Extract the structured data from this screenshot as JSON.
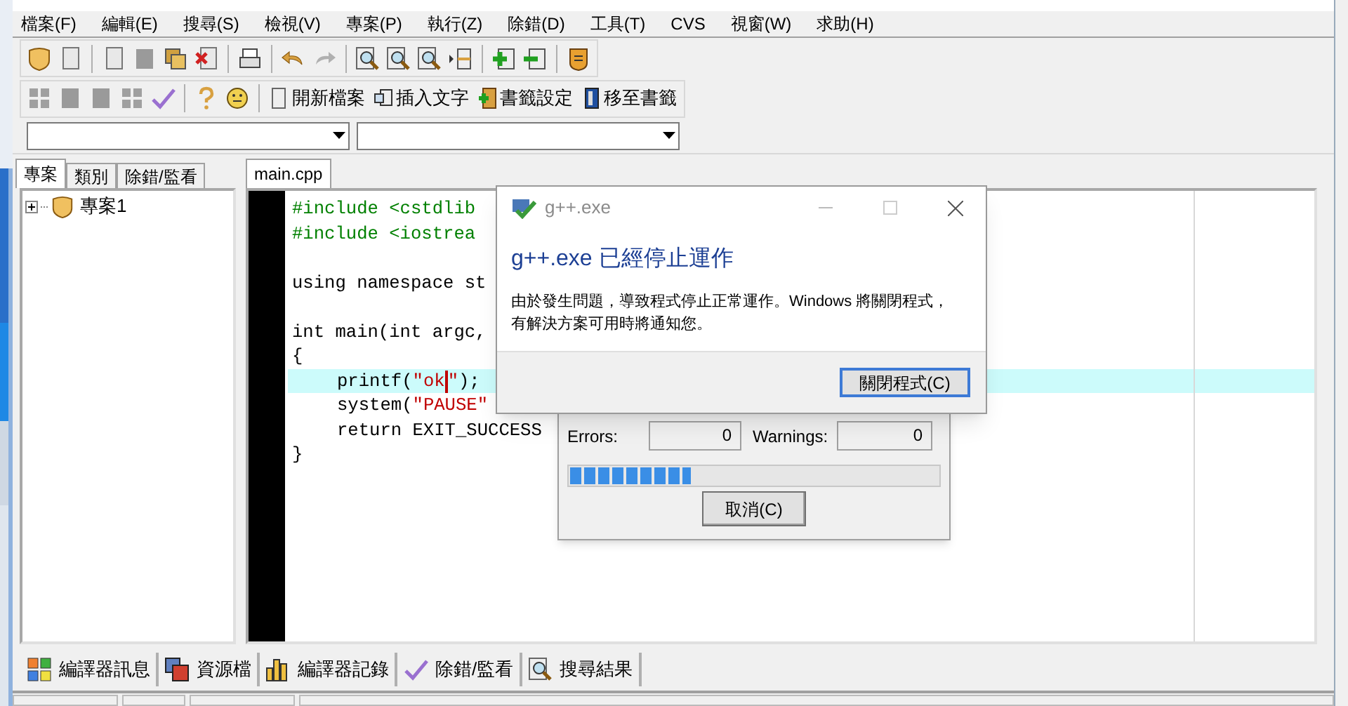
{
  "menu": [
    {
      "label": "檔案(F)"
    },
    {
      "label": "編輯(E)"
    },
    {
      "label": "搜尋(S)"
    },
    {
      "label": "檢視(V)"
    },
    {
      "label": "專案(P)"
    },
    {
      "label": "執行(Z)"
    },
    {
      "label": "除錯(D)"
    },
    {
      "label": "工具(T)"
    },
    {
      "label": "CVS"
    },
    {
      "label": "視窗(W)"
    },
    {
      "label": "求助(H)"
    }
  ],
  "toolbar_buttons": [
    {
      "label": "開新檔案",
      "kind": "page"
    },
    {
      "label": "插入文字",
      "kind": "insert"
    },
    {
      "label": "書籤設定",
      "kind": "bookmark-add"
    },
    {
      "label": "移至書籤",
      "kind": "bookmark-go"
    }
  ],
  "left_tabs": [
    {
      "label": "專案",
      "selected": true
    },
    {
      "label": "類別",
      "selected": false
    },
    {
      "label": "除錯/監看",
      "selected": false
    }
  ],
  "project_tree": [
    {
      "label": "專案1",
      "expanded": false
    }
  ],
  "editor_tabs": [
    {
      "label": "main.cpp",
      "selected": true
    }
  ],
  "code_lines": [
    {
      "indented": false,
      "highlighted": false,
      "tokens": [
        {
          "kind": "preprocessor",
          "text": "#include <cstdlib"
        }
      ]
    },
    {
      "indented": false,
      "highlighted": false,
      "tokens": [
        {
          "kind": "preprocessor",
          "text": "#include <iostrea"
        }
      ]
    },
    {
      "highlighted": false
    },
    {
      "indented": false,
      "highlighted": false,
      "tokens": [
        {
          "kind": "plain",
          "text": "using namespace st"
        }
      ]
    },
    {
      "highlighted": false
    },
    {
      "indented": false,
      "highlighted": false,
      "tokens": [
        {
          "kind": "plain",
          "text": "int main(int argc,"
        }
      ]
    },
    {
      "indented": false,
      "highlighted": false,
      "tokens": [
        {
          "kind": "plain",
          "text": "{"
        }
      ]
    },
    {
      "indented": true,
      "highlighted": true,
      "tokens": [
        {
          "kind": "plain",
          "text": "printf("
        },
        {
          "kind": "string",
          "text": "\"ok"
        },
        {
          "kind": "caret"
        },
        {
          "kind": "string",
          "text": "\""
        },
        {
          "kind": "plain",
          "text": ");"
        }
      ]
    },
    {
      "indented": true,
      "highlighted": false,
      "tokens": [
        {
          "kind": "plain",
          "text": "system("
        },
        {
          "kind": "string",
          "text": "\"PAUSE\""
        }
      ]
    },
    {
      "indented": true,
      "highlighted": false,
      "tokens": [
        {
          "kind": "plain",
          "text": "return EXIT_SUCCESS"
        }
      ]
    },
    {
      "indented": false,
      "highlighted": false,
      "tokens": [
        {
          "kind": "plain",
          "text": "}"
        }
      ]
    }
  ],
  "bottom_tabs": [
    {
      "label": "編譯器訊息",
      "kind": "grid",
      "selected": false
    },
    {
      "label": "資源檔",
      "kind": "layers",
      "selected": false
    },
    {
      "label": "編譯器記錄",
      "kind": "bars",
      "selected": false
    },
    {
      "label": "除錯/監看",
      "kind": "check",
      "selected": false
    },
    {
      "label": "搜尋結果",
      "kind": "search",
      "selected": false
    }
  ],
  "compile_dialog": {
    "errors_label": "Errors:",
    "errors": "0",
    "warnings_label": "Warnings:",
    "warnings": "0",
    "level": 0.33,
    "cancel": "取消(C)"
  },
  "error_dialog": {
    "title": "g++.exe",
    "heading": "g++.exe 已經停止運作",
    "message": "由於發生問題，導致程式停止正常運作。Windows 將關閉程式，有解決方案可用時將通知您。",
    "button": "關閉程式(C)"
  }
}
